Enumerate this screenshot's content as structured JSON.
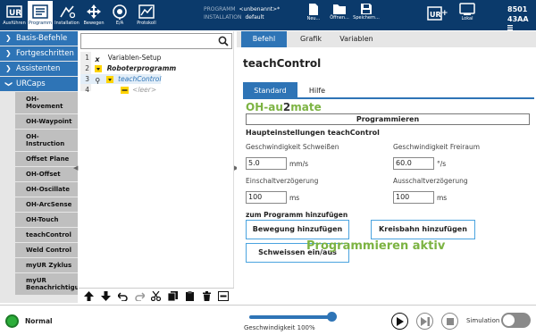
{
  "topbar": {
    "buttons": [
      {
        "label": "Ausführen",
        "icon": "ur-logo-icon"
      },
      {
        "label": "Programm",
        "icon": "program-icon"
      },
      {
        "label": "Installation",
        "icon": "installation-icon"
      },
      {
        "label": "Bewegen",
        "icon": "move-icon"
      },
      {
        "label": "E/A",
        "icon": "io-icon"
      },
      {
        "label": "Protokoll",
        "icon": "log-icon"
      }
    ],
    "program_label": "PROGRAMM",
    "program_value": "<unbenannt>*",
    "installation_label": "INSTALLATION",
    "installation_value": "default",
    "file_buttons": [
      {
        "label": "Neu...",
        "icon": "new-file-icon"
      },
      {
        "label": "Öffnen...",
        "icon": "open-folder-icon"
      },
      {
        "label": "Speichern...",
        "icon": "save-icon"
      }
    ],
    "local_label": "Lokal",
    "robot_id_line1": "8501",
    "robot_id_line2": "43AA"
  },
  "leftnav": {
    "categories": [
      {
        "label": "Basis-Befehle"
      },
      {
        "label": "Fortgeschritten"
      },
      {
        "label": "Assistenten"
      },
      {
        "label": "URCaps"
      }
    ],
    "items": [
      {
        "label": "OH-\nMovement"
      },
      {
        "label": "OH-Waypoint"
      },
      {
        "label": "OH-\nInstruction"
      },
      {
        "label": "Offset Plane"
      },
      {
        "label": "OH-Offset"
      },
      {
        "label": "OH-Oscillate"
      },
      {
        "label": "OH-ArcSense"
      },
      {
        "label": "OH-Touch"
      },
      {
        "label": "teachControl"
      },
      {
        "label": "Weld Control"
      },
      {
        "label": "myUR Zyklus"
      },
      {
        "label": "myUR\nBenachrichtigu"
      }
    ]
  },
  "tree": {
    "rows": [
      {
        "num": "1",
        "text": "Variablen-Setup"
      },
      {
        "num": "2",
        "text": "Roboterprogramm"
      },
      {
        "num": "3",
        "text": "teachControl"
      },
      {
        "num": "4",
        "text": "<leer>"
      }
    ]
  },
  "tabs": [
    {
      "label": "Befehl"
    },
    {
      "label": "Grafik"
    },
    {
      "label": "Variablen"
    }
  ],
  "content": {
    "title": "teachControl",
    "subtabs": [
      {
        "label": "Standard"
      },
      {
        "label": "Hilfe"
      }
    ],
    "logo_a": "OH-au",
    "logo_b": "2",
    "logo_c": "mate",
    "program_button": "Programmieren",
    "section_head": "Haupteinstellungen teachControl",
    "weld_speed_label": "Geschwindigkeit Schweißen",
    "weld_speed_value": "5.0",
    "weld_speed_unit": "mm/s",
    "free_speed_label": "Geschwindigkeit Freiraum",
    "free_speed_value": "60.0",
    "free_speed_unit": "°/s",
    "on_delay_label": "Einschaltverzögerung",
    "on_delay_value": "100",
    "on_delay_unit": "ms",
    "off_delay_label": "Ausschaltverzögerung",
    "off_delay_value": "100",
    "off_delay_unit": "ms",
    "add_head": "zum Programm hinzufügen",
    "move_button": "Bewegung hinzufügen",
    "circle_button": "Kreisbahn hinzufügen",
    "weld_button": "Schweissen ein/aus",
    "status_text": "Programmieren aktiv"
  },
  "bottombar": {
    "status": "Normal",
    "speed_label": "Geschwindigkeit 100%",
    "speed_fraction": 1.0,
    "simulation_label": "Simulation",
    "simulation_on": false
  },
  "colors": {
    "topbar": "#0b3a6b",
    "accent": "#2e74b6",
    "logo_green": "#7cb342",
    "status_green": "#2cae3a"
  }
}
